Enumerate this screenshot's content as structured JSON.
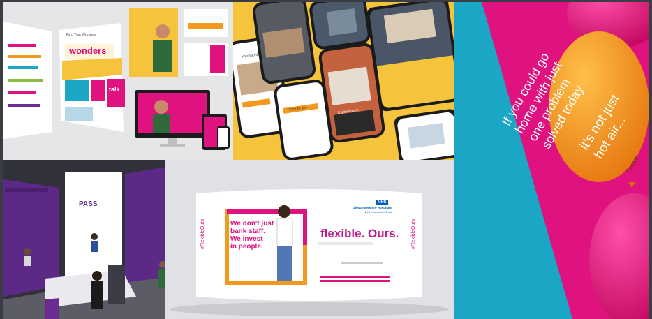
{
  "tiles": {
    "print_web": {
      "brochure_title": "wonders",
      "brochure_heading": "Find Your Wonders",
      "poster_word": "talk"
    },
    "mobile": {
      "screen_heading": "Your Words",
      "button_label": "Explore more",
      "card_label": "Click to see"
    },
    "balloons": {
      "panel_text_lines": [
        "If you could go",
        "home with just",
        "one problem",
        "solved today"
      ],
      "balloon_text_lines": [
        "it's not just",
        "hot air..."
      ],
      "balloon_tag": "Cornet"
    },
    "exhibition": {
      "brand": "PASS"
    },
    "banner": {
      "headline_lines": [
        "We don't just",
        "bank staff.",
        "We invest",
        "in people."
      ],
      "tagline": "flexible. Ours.",
      "hashtag": "#FlexibleOurs",
      "nhs_logo": "NHS",
      "org_name_lines": [
        "Gloucestershire Hospitals",
        "NHS Foundation Trust"
      ]
    }
  },
  "colors": {
    "magenta": "#e0127f",
    "yellow": "#f6c33c",
    "purple": "#6a2c91",
    "teal": "#1aa6c4",
    "orange": "#f39a1e"
  }
}
